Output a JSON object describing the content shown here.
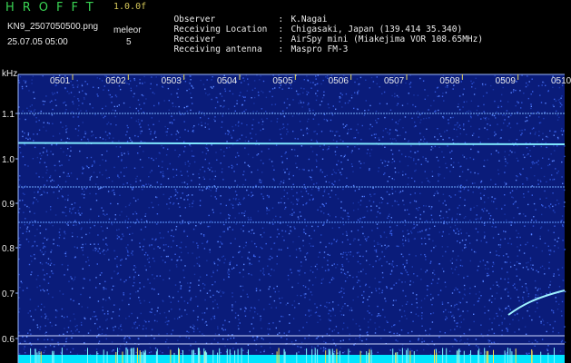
{
  "header": {
    "app_title": "HROFFT",
    "version": "1.0.0f",
    "filename": "KN9_2507050500.png",
    "mode_label": "meleor",
    "timestamp": "25.07.05 05:00",
    "mode_value": "5"
  },
  "info": [
    {
      "key": "Observer",
      "value": "K.Nagai"
    },
    {
      "key": "Receiving Location",
      "value": "Chigasaki, Japan (139.414 35.340)"
    },
    {
      "key": "Receiver",
      "value": "AirSpy mini (Miakejima VOR 108.65MHz)"
    },
    {
      "key": "Receiving antenna",
      "value": "Maspro FM-3"
    }
  ],
  "spectrogram": {
    "y_unit": "kHz",
    "y_ticks": [
      "1.1",
      "1.0",
      "0.9",
      "0.8",
      "0.7",
      "0.6"
    ],
    "x_ticks": [
      "0501",
      "0502",
      "0503",
      "0504",
      "0505",
      "0506",
      "0507",
      "0508",
      "0509",
      "0510"
    ],
    "colors": {
      "background": "#0a1c7a",
      "noise": "#2f54d6",
      "carrier": "#7fe8ff",
      "baseline": "#00e5ff"
    }
  }
}
